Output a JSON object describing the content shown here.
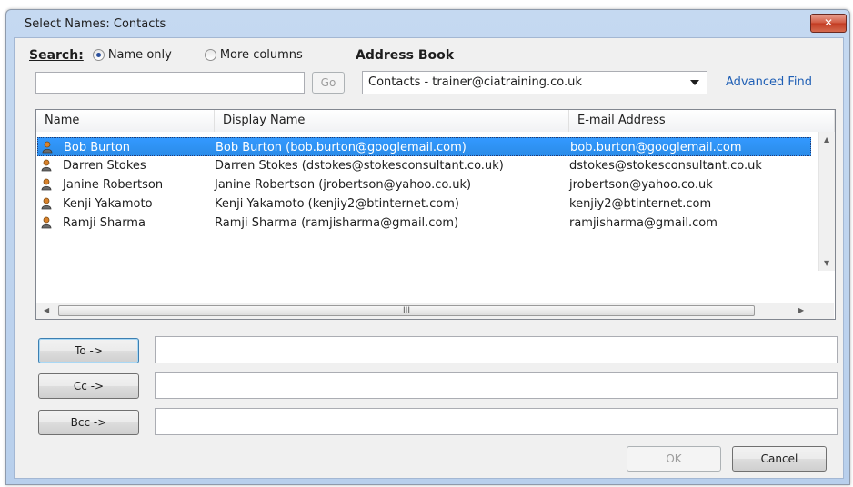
{
  "window": {
    "title": "Select Names: Contacts",
    "close_glyph": "✕"
  },
  "search": {
    "label": "Search:",
    "radio_name_only": "Name only",
    "radio_more_columns": "More columns",
    "input_value": "",
    "go_label": "Go"
  },
  "address_book": {
    "label": "Address Book",
    "selected": "Contacts - trainer@ciatraining.co.uk",
    "advanced_find": "Advanced Find"
  },
  "table": {
    "columns": [
      "Name",
      "Display Name",
      "E-mail Address"
    ],
    "rows": [
      {
        "name": "Bob Burton",
        "display": "Bob Burton (bob.burton@googlemail.com)",
        "email": "bob.burton@googlemail.com",
        "selected": true
      },
      {
        "name": "Darren Stokes",
        "display": "Darren Stokes (dstokes@stokesconsultant.co.uk)",
        "email": "dstokes@stokesconsultant.co.uk",
        "selected": false
      },
      {
        "name": "Janine Robertson",
        "display": "Janine Robertson (jrobertson@yahoo.co.uk)",
        "email": "jrobertson@yahoo.co.uk",
        "selected": false
      },
      {
        "name": "Kenji Yakamoto",
        "display": "Kenji Yakamoto (kenjiy2@btinternet.com)",
        "email": "kenjiy2@btinternet.com",
        "selected": false
      },
      {
        "name": "Ramji Sharma",
        "display": "Ramji Sharma (ramjisharma@gmail.com)",
        "email": "ramjisharma@gmail.com",
        "selected": false
      }
    ],
    "scroll_thumb_grip": "III"
  },
  "recipients": {
    "to_label": "To ->",
    "cc_label": "Cc ->",
    "bcc_label": "Bcc ->",
    "to_value": "",
    "cc_value": "",
    "bcc_value": ""
  },
  "footer": {
    "ok_label": "OK",
    "cancel_label": "Cancel"
  },
  "colors": {
    "selection": "#3399ff",
    "link": "#1f5fb5",
    "title_bar": "#c5d9f1"
  }
}
